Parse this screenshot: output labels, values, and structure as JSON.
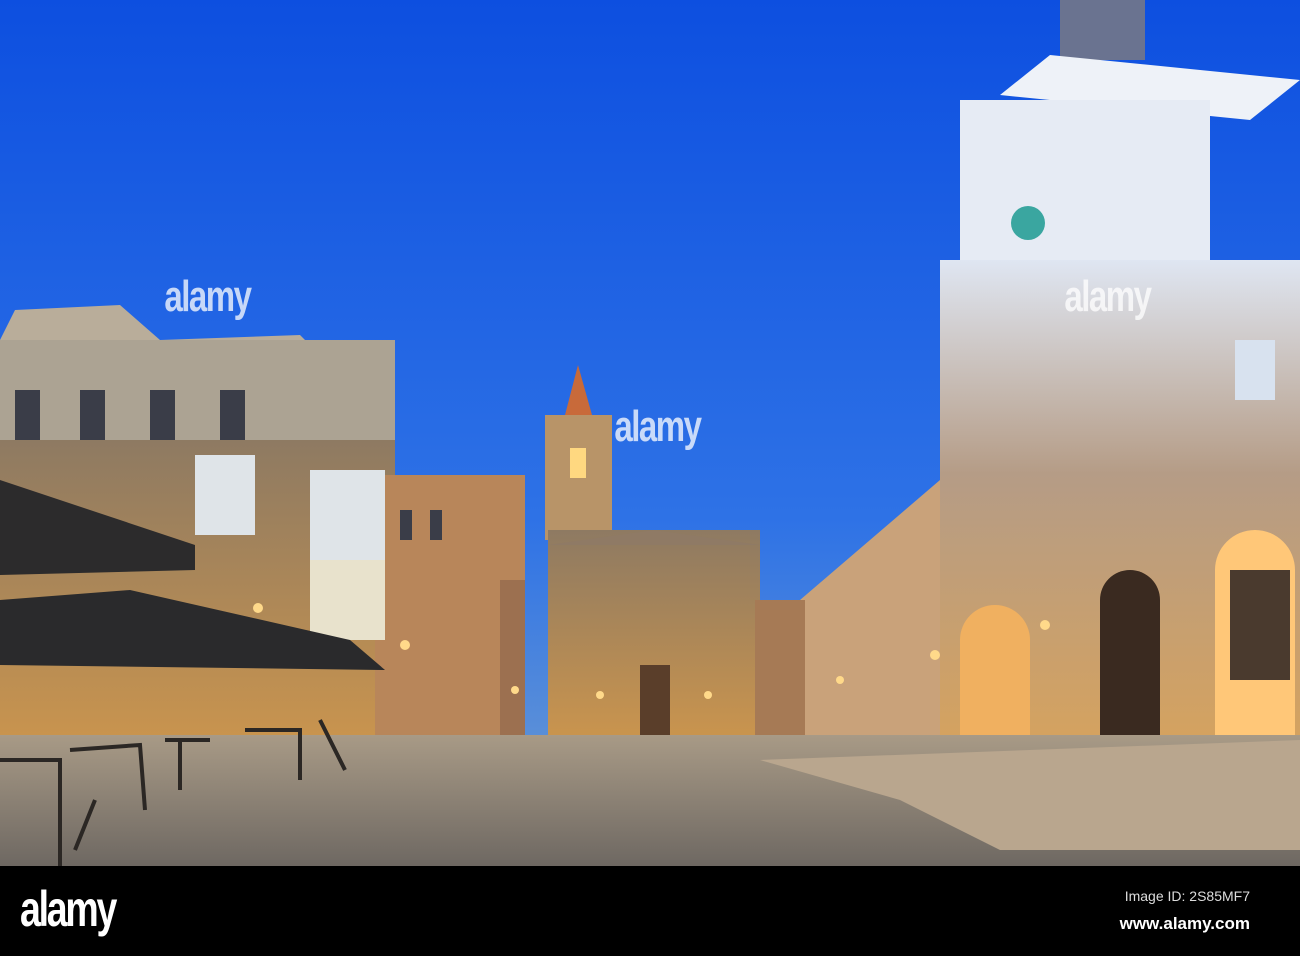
{
  "watermark": {
    "logo": "alamy",
    "image_id": "Image ID: 2S85MF7",
    "url": "www.alamy.com"
  },
  "colors": {
    "sky_top": "#0d4fe0",
    "sky_bottom": "#4a8ae8",
    "stone": "#b58a55",
    "lamp": "#ffd98a",
    "ground": "#7d7670"
  }
}
